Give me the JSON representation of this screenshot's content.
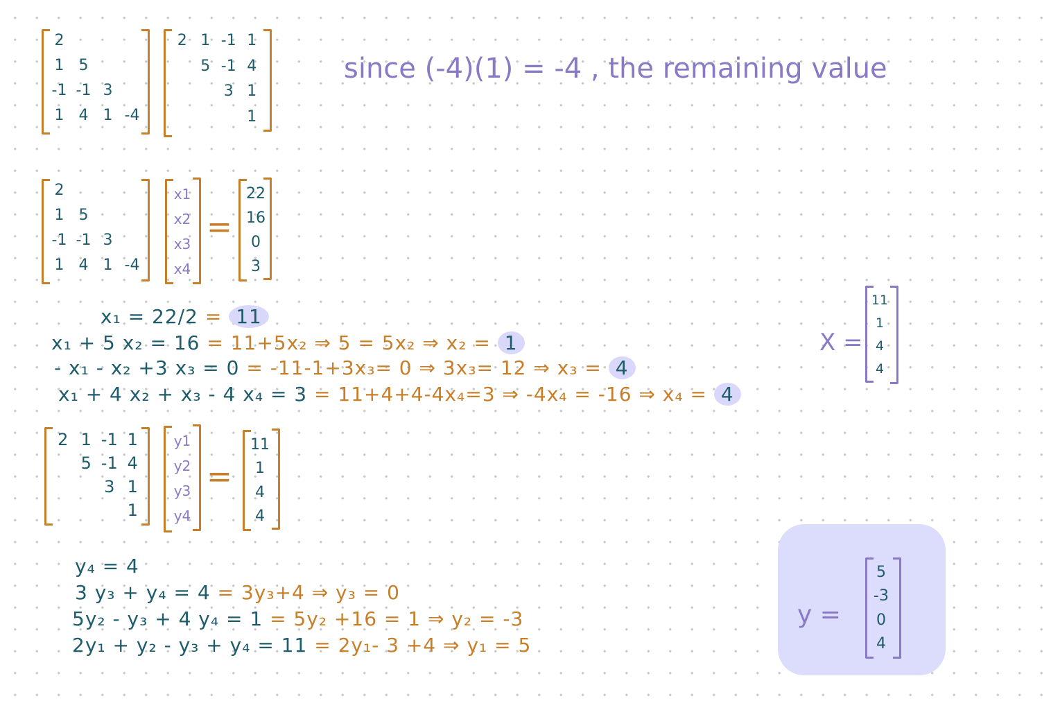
{
  "note": "since (-4)(1) = -4 , the remaining value",
  "L_rows": [
    [
      "2",
      "",
      "",
      ""
    ],
    [
      "1",
      "5",
      "",
      ""
    ],
    [
      "-1",
      "-1",
      "3",
      ""
    ],
    [
      "1",
      "4",
      "1",
      "-4"
    ]
  ],
  "U_rows": [
    [
      "2",
      "1",
      "-1",
      "1"
    ],
    [
      "",
      "5",
      "-1",
      "4"
    ],
    [
      "",
      "",
      "3",
      "1"
    ],
    [
      "",
      "",
      "",
      "1"
    ]
  ],
  "x_vars": [
    "x1",
    "x2",
    "x3",
    "x4"
  ],
  "b_vals": [
    "22",
    "16",
    "0",
    "3"
  ],
  "y_vars": [
    "y1",
    "y2",
    "y3",
    "y4"
  ],
  "x_vals": [
    "11",
    "1",
    "4",
    "4"
  ],
  "y_vals": [
    "5",
    "-3",
    "0",
    "4"
  ],
  "eq_sign": "=",
  "x_label": "X =",
  "y_label": "y =",
  "fwd": [
    {
      "a": "x₁ = 22/2 ",
      "b": "= ",
      "c": "11"
    },
    {
      "a": "x₁ + 5 x₂ = 16 ",
      "b": "= 11+5x₂ ⇒ 5 = 5x₂ ⇒ x₂ = ",
      "c": "1"
    },
    {
      "a": "- x₁ - x₂ +3 x₃ = 0 ",
      "b": "= -11-1+3x₃= 0 ⇒ 3x₃= 12 ⇒ x₃ = ",
      "c": "4"
    },
    {
      "a": "x₁ + 4 x₂ + x₃ - 4 x₄ = 3 ",
      "b": "= 11+4+4-4x₄=3 ⇒ -4x₄ = -16 ⇒ x₄ = ",
      "c": "4"
    }
  ],
  "back": [
    {
      "a": "y₄ = 4",
      "b": ""
    },
    {
      "a": "3 y₃ + y₄ = 4 ",
      "b": "= 3y₃+4 ⇒ y₃ = 0"
    },
    {
      "a": "5y₂ - y₃ + 4 y₄ = 1 ",
      "b": "= 5y₂ +16 = 1 ⇒ y₂ = -3"
    },
    {
      "a": "2y₁ + y₂ - y₃ + y₄ = 11 ",
      "b": "= 2y₁- 3 +4 ⇒ y₁ = 5"
    }
  ]
}
